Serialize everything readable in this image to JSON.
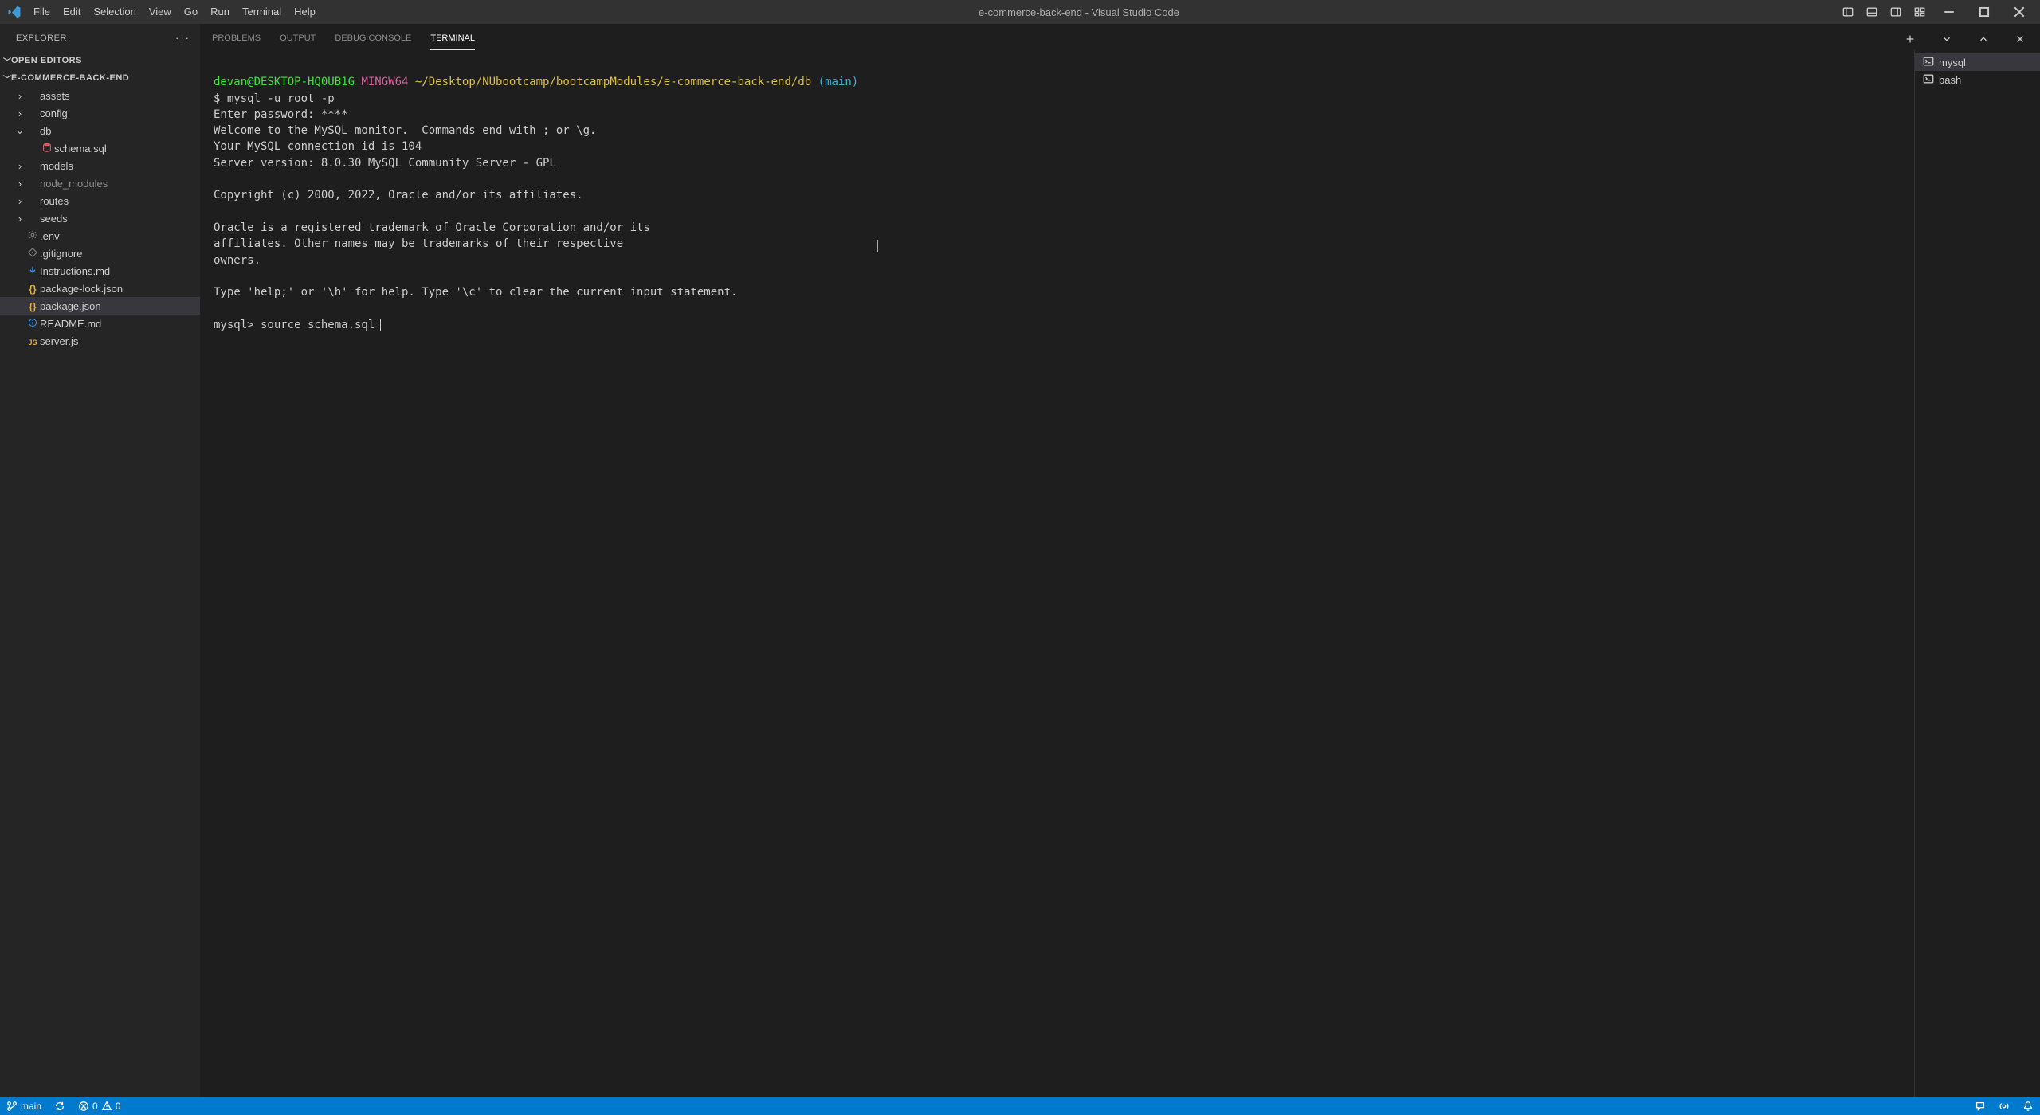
{
  "title": "e-commerce-back-end - Visual Studio Code",
  "menu": [
    "File",
    "Edit",
    "Selection",
    "View",
    "Go",
    "Run",
    "Terminal",
    "Help"
  ],
  "sidebar": {
    "title": "EXPLORER",
    "open_editors_label": "OPEN EDITORS",
    "project_label": "E-COMMERCE-BACK-END",
    "items": [
      {
        "label": "assets",
        "type": "folder",
        "indent": 1,
        "open": false
      },
      {
        "label": "config",
        "type": "folder",
        "indent": 1,
        "open": false
      },
      {
        "label": "db",
        "type": "folder",
        "indent": 1,
        "open": true
      },
      {
        "label": "schema.sql",
        "type": "file",
        "indent": 2,
        "icon": "sql"
      },
      {
        "label": "models",
        "type": "folder",
        "indent": 1,
        "open": false
      },
      {
        "label": "node_modules",
        "type": "folder",
        "indent": 1,
        "open": false,
        "dim": true
      },
      {
        "label": "routes",
        "type": "folder",
        "indent": 1,
        "open": false
      },
      {
        "label": "seeds",
        "type": "folder",
        "indent": 1,
        "open": false
      },
      {
        "label": ".env",
        "type": "file",
        "indent": 1,
        "icon": "gear"
      },
      {
        "label": ".gitignore",
        "type": "file",
        "indent": 1,
        "icon": "gitignore"
      },
      {
        "label": "Instructions.md",
        "type": "file",
        "indent": 1,
        "icon": "arrowdown"
      },
      {
        "label": "package-lock.json",
        "type": "file",
        "indent": 1,
        "icon": "json"
      },
      {
        "label": "package.json",
        "type": "file",
        "indent": 1,
        "icon": "json",
        "active": true
      },
      {
        "label": "README.md",
        "type": "file",
        "indent": 1,
        "icon": "info"
      },
      {
        "label": "server.js",
        "type": "file",
        "indent": 1,
        "icon": "js"
      }
    ]
  },
  "panel": {
    "tabs": [
      "PROBLEMS",
      "OUTPUT",
      "DEBUG CONSOLE",
      "TERMINAL"
    ],
    "active_tab": "TERMINAL",
    "terminals": [
      {
        "label": "mysql",
        "active": true
      },
      {
        "label": "bash",
        "active": false
      }
    ]
  },
  "terminal": {
    "prompt_user": "devan@DESKTOP-HQ0UB1G",
    "prompt_sys": "MINGW64",
    "prompt_path": "~/Desktop/NUbootcamp/bootcampModules/e-commerce-back-end/db",
    "prompt_branch": "(main)",
    "line_mysql_cmd": "$ mysql -u root -p",
    "line_pass": "Enter password: ****",
    "line_welcome": "Welcome to the MySQL monitor.  Commands end with ; or \\g.",
    "line_conn": "Your MySQL connection id is 104",
    "line_server": "Server version: 8.0.30 MySQL Community Server - GPL",
    "line_copy": "Copyright (c) 2000, 2022, Oracle and/or its affiliates.",
    "line_tm1": "Oracle is a registered trademark of Oracle Corporation and/or its",
    "line_tm2": "affiliates. Other names may be trademarks of their respective",
    "line_tm3": "owners.",
    "line_help": "Type 'help;' or '\\h' for help. Type '\\c' to clear the current input statement.",
    "line_input": "mysql> source schema.sql"
  },
  "statusbar": {
    "branch": "main",
    "errors": "0",
    "warnings": "0"
  }
}
